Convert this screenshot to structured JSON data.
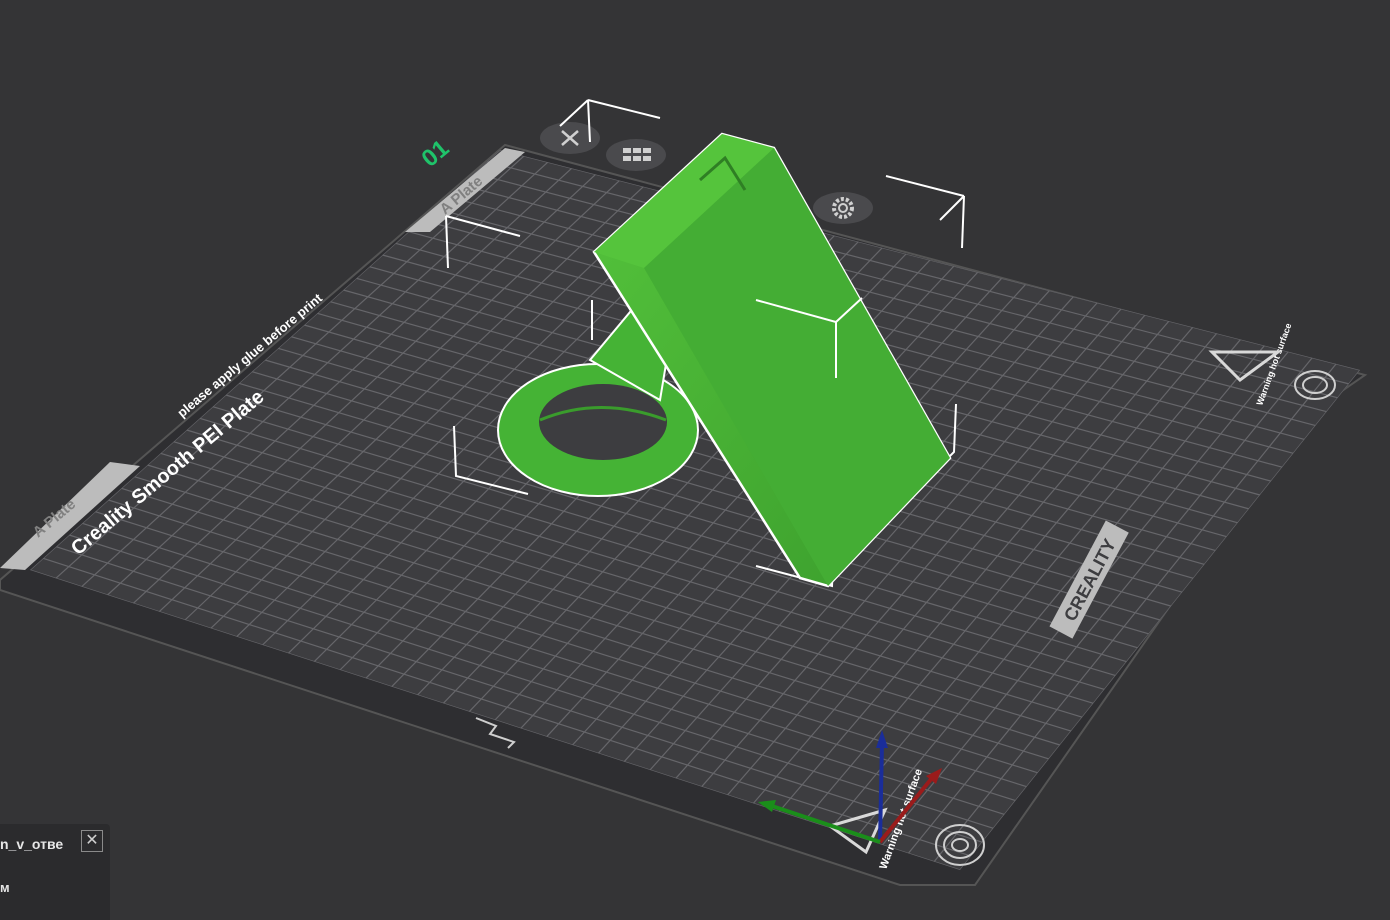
{
  "viewport": {
    "plate_number": "01",
    "plate_tab_label": "A Plate",
    "plate_tab_label_2": "A Plate",
    "bed_name": "Creality Smooth PEI Plate",
    "bed_notice": "please apply glue before print",
    "brand": "CREALITY",
    "warning_text": "Warning hot surface",
    "warning_text_2": "Warning hot surface",
    "model_color": "#45b335",
    "bed_color": "#3d3d40",
    "grid_color": "#66666a",
    "plate_number_color": "#1fc36a"
  },
  "object_panel": {
    "filename": "n_v_отве",
    "close_icon": "close-icon",
    "sub_label": "м"
  },
  "axes": {
    "x_color": "#9a1b1b",
    "y_color": "#1a8e1a",
    "z_color": "#1a2d9a"
  }
}
